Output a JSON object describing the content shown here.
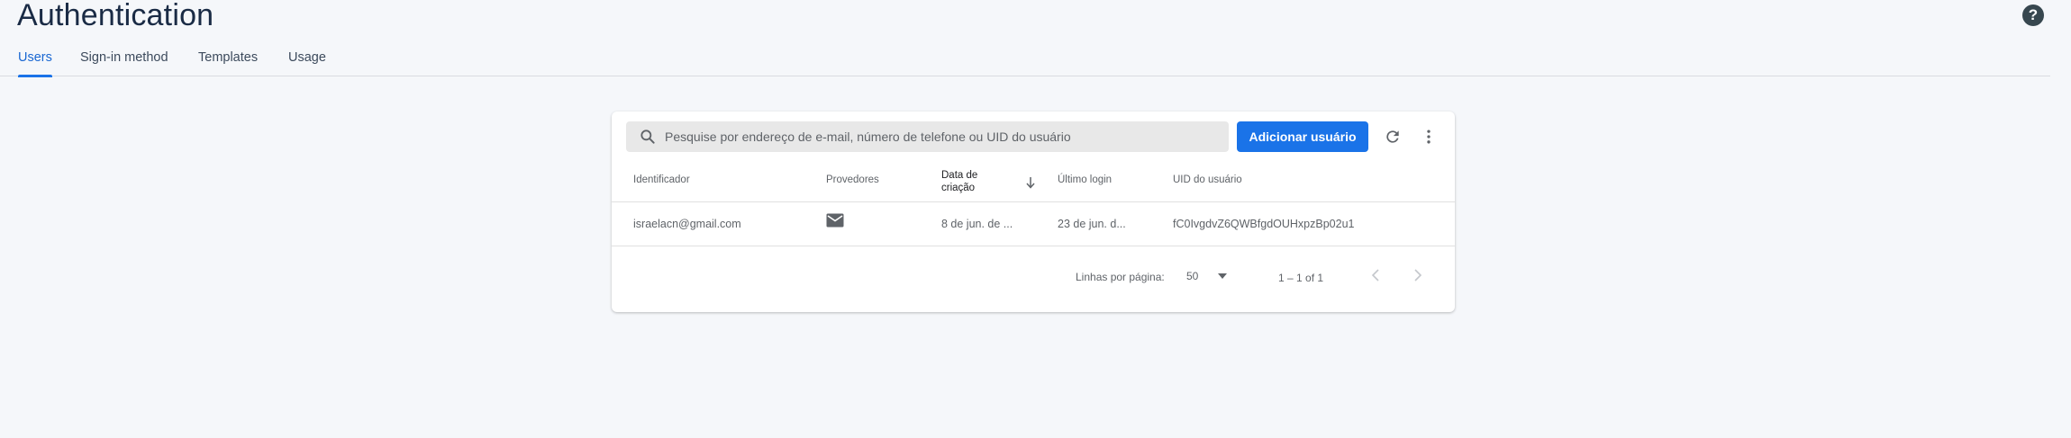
{
  "header": {
    "title": "Authentication",
    "help_icon": "help-icon",
    "help_symbol": "?"
  },
  "tabs": [
    {
      "label": "Users",
      "active": true
    },
    {
      "label": "Sign-in method",
      "active": false
    },
    {
      "label": "Templates",
      "active": false
    },
    {
      "label": "Usage",
      "active": false
    }
  ],
  "toolbar": {
    "search_placeholder": "Pesquise por endereço de e-mail, número de telefone ou UID do usuário",
    "search_value": "",
    "add_user_label": "Adicionar usuário",
    "refresh_icon": "refresh-icon",
    "more_icon": "more-vert-icon"
  },
  "table": {
    "columns": [
      {
        "label": "Identificador"
      },
      {
        "label": "Provedores"
      },
      {
        "label": "Data de criação",
        "sorted": "descending"
      },
      {
        "label": "Último login"
      },
      {
        "label": "UID do usuário"
      }
    ],
    "rows": [
      {
        "identifier": "israelacn@gmail.com",
        "provider_icon": "mail-icon",
        "created": "8 de jun. de ...",
        "last_login": "23 de jun. d...",
        "uid": "fC0IvgdvZ6QWBfgdOUHxpzBp02u1"
      }
    ]
  },
  "pagination": {
    "rows_per_page_label": "Linhas por página:",
    "rows_per_page_value": "50",
    "range": "1 – 1 of 1",
    "prev_icon": "chevron-left-icon",
    "next_icon": "chevron-right-icon"
  },
  "colors": {
    "accent": "#1a73e8",
    "background": "#f5f7fa",
    "title": "#1a2b45"
  }
}
